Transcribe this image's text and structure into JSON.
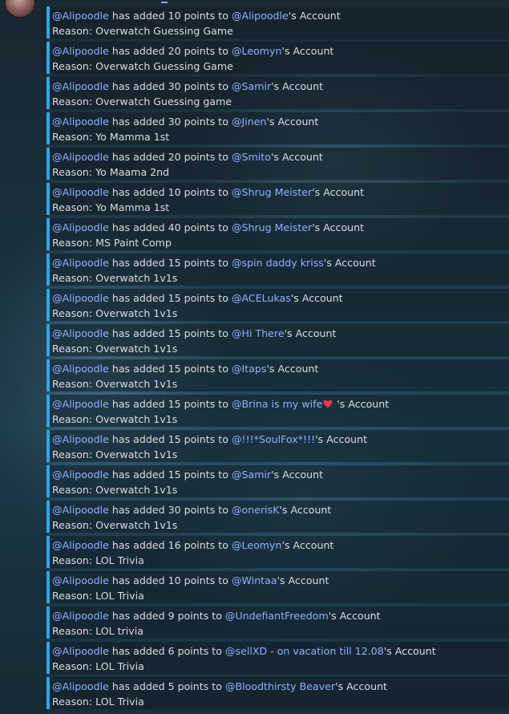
{
  "messages": [
    {
      "actor": "@Alipoodle",
      "prefix": " has added 10 points to ",
      "target": "@Alipoodle",
      "suffix": "'s Account",
      "reason": "Reason: Overwatch Guessing Game"
    },
    {
      "actor": "@Alipoodle",
      "prefix": " has added 20 points to ",
      "target": "@Leomyn",
      "suffix": "'s Account",
      "reason": "Reason: Overwatch Guessing Game"
    },
    {
      "actor": "@Alipoodle",
      "prefix": " has added 30 points to ",
      "target": "@Samir",
      "suffix": "'s Account",
      "reason": "Reason: Overwatch Guessing game"
    },
    {
      "actor": "@Alipoodle",
      "prefix": " has added 30 points to ",
      "target": "@Jinen",
      "suffix": "'s Account",
      "reason": "Reason: Yo Mamma 1st"
    },
    {
      "actor": "@Alipoodle",
      "prefix": " has added 20 points to ",
      "target": "@Smito",
      "suffix": "'s Account",
      "reason": "Reason: Yo Maama 2nd"
    },
    {
      "actor": "@Alipoodle",
      "prefix": " has added 10 points to ",
      "target": "@Shrug Meister",
      "suffix": "'s Account",
      "reason": "Reason: Yo Mamma 1st"
    },
    {
      "actor": "@Alipoodle",
      "prefix": " has added 40 points to ",
      "target": "@Shrug Meister",
      "suffix": "'s Account",
      "reason": "Reason: MS Paint Comp"
    },
    {
      "actor": "@Alipoodle",
      "prefix": " has added 15 points to ",
      "target": "@spin daddy kriss",
      "suffix": "'s Account",
      "reason": "Reason: Overwatch 1v1s"
    },
    {
      "actor": "@Alipoodle",
      "prefix": " has added 15 points to ",
      "target": "@ACELukas",
      "suffix": "'s Account",
      "reason": "Reason: Overwatch 1v1s"
    },
    {
      "actor": "@Alipoodle",
      "prefix": " has added 15 points to ",
      "target": "@Hi There",
      "suffix": "'s Account",
      "reason": "Reason: Overwatch 1v1s"
    },
    {
      "actor": "@Alipoodle",
      "prefix": " has added 15 points to ",
      "target": "@Itaps",
      "suffix": "'s Account",
      "reason": "Reason: Overwatch 1v1s"
    },
    {
      "actor": "@Alipoodle",
      "prefix": " has added 15 points to ",
      "target": "@Brina is my wife",
      "suffix": " 's Account",
      "reason": "Reason: Overwatch 1v1s",
      "heart": true
    },
    {
      "actor": "@Alipoodle",
      "prefix": " has added 15 points to ",
      "target": "@!!!*SoulFox*!!!",
      "suffix": "'s Account",
      "reason": "Reason: Overwatch 1v1s"
    },
    {
      "actor": "@Alipoodle",
      "prefix": " has added 15 points to ",
      "target": "@Samir",
      "suffix": "'s Account",
      "reason": "Reason: Overwatch 1v1s"
    },
    {
      "actor": "@Alipoodle",
      "prefix": " has added 30 points to ",
      "target": "@onerisK",
      "suffix": "'s Account",
      "reason": "Reason: Overwatch 1v1s"
    },
    {
      "actor": "@Alipoodle",
      "prefix": " has added 16 points to ",
      "target": "@Leomyn",
      "suffix": "'s Account",
      "reason": "Reason: LOL Trivia"
    },
    {
      "actor": "@Alipoodle",
      "prefix": " has added 10 points to ",
      "target": "@Wintaa",
      "suffix": "'s Account",
      "reason": "Reason: LOL Trivia"
    },
    {
      "actor": "@Alipoodle",
      "prefix": " has added 9 points to ",
      "target": "@UndefiantFreedom",
      "suffix": "'s Account",
      "reason": "Reason: LOL trivia"
    },
    {
      "actor": "@Alipoodle",
      "prefix": " has added 6 points to ",
      "target": "@sellXD - on vacation till 12.08",
      "suffix": "'s Account",
      "reason": "Reason: LOL Trivia"
    },
    {
      "actor": "@Alipoodle",
      "prefix": " has added 5 points to ",
      "target": "@Bloodthirsty Beaver",
      "suffix": "'s Account",
      "reason": "Reason: LOL Trivia"
    }
  ],
  "colors": {
    "accent_border": "#2aa8e8",
    "mention": "#8fb0ff",
    "text": "#d8dde1"
  },
  "icons": {
    "heart": "heart-icon"
  }
}
